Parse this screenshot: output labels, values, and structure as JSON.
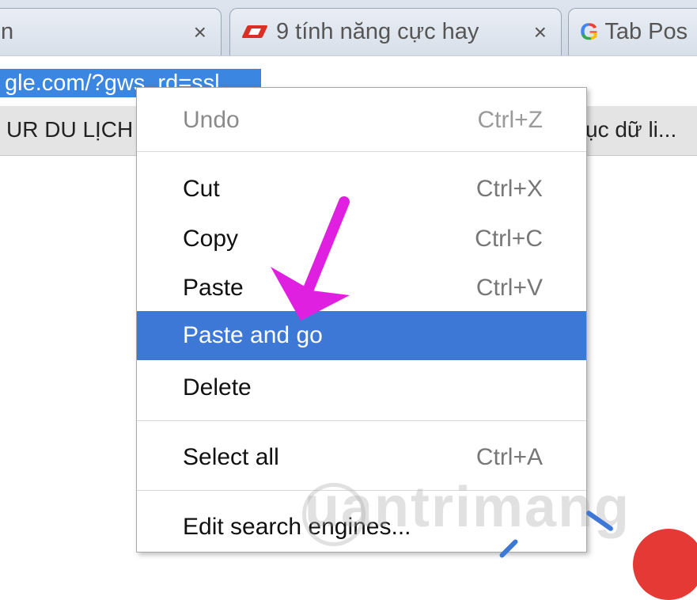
{
  "tabs": [
    {
      "title": "n",
      "close": "×"
    },
    {
      "title": "9 tính năng cực hay",
      "close": "×",
      "icon": "red-parallelogram-icon"
    },
    {
      "title": "Tab Pos",
      "icon": "google-g-icon",
      "icon_glyph": "G"
    }
  ],
  "address_bar": {
    "url": "gle.com/?gws_rd=ssl"
  },
  "bookmarks": {
    "left": "UR DU LỊCH",
    "right": "ục dữ li..."
  },
  "context_menu": {
    "items": [
      {
        "label": "Undo",
        "shortcut": "Ctrl+Z",
        "enabled": false
      },
      {
        "label": "Cut",
        "shortcut": "Ctrl+X",
        "enabled": true
      },
      {
        "label": "Copy",
        "shortcut": "Ctrl+C",
        "enabled": true
      },
      {
        "label": "Paste",
        "shortcut": "Ctrl+V",
        "enabled": true
      },
      {
        "label": "Paste and go",
        "shortcut": "",
        "enabled": true,
        "highlighted": true
      },
      {
        "label": "Delete",
        "shortcut": "",
        "enabled": true
      },
      {
        "label": "Select all",
        "shortcut": "Ctrl+A",
        "enabled": true
      },
      {
        "label": "Edit search engines...",
        "shortcut": "",
        "enabled": true
      }
    ]
  },
  "annotation": {
    "arrow_color": "#e020e0",
    "points_to": "Paste and go"
  },
  "colors": {
    "selection": "#3a86e0",
    "menu_highlight": "#3e78d6"
  },
  "watermark": "uantrimang"
}
